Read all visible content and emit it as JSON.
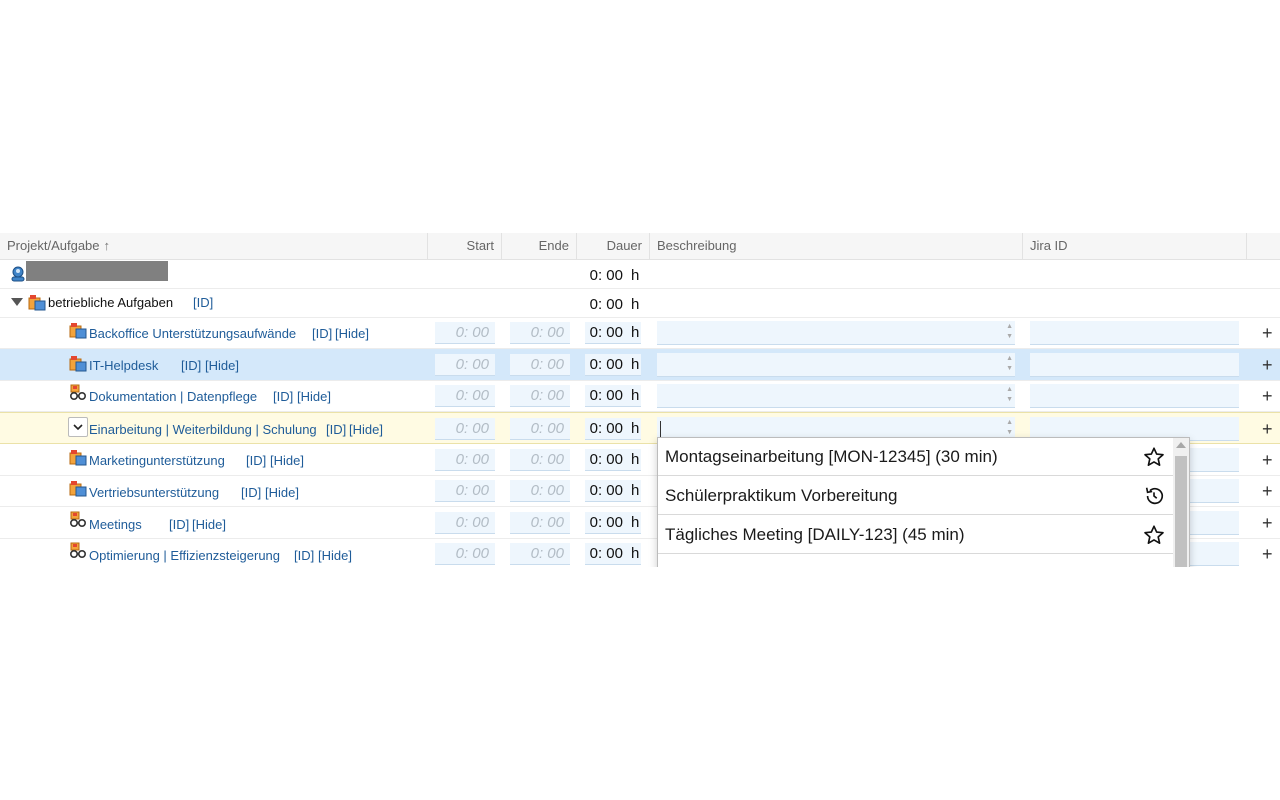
{
  "columns": {
    "task": "Projekt/Aufgabe",
    "start": "Start",
    "end": "Ende",
    "duration": "Dauer",
    "description": "Beschreibung",
    "jira": "Jira ID"
  },
  "summary_row": {
    "duration": "0: 00",
    "unit": "h"
  },
  "group": {
    "name": "betriebliche Aufgaben",
    "id_link": "[ID]",
    "duration": "0: 00",
    "unit": "h"
  },
  "time_placeholder": "0: 00",
  "tasks": [
    {
      "name": "Backoffice Unterstützungsaufwände",
      "id_link": "[ID]",
      "hide_link": "[Hide]",
      "duration": "0: 00",
      "unit": "h",
      "icon": "project-icon"
    },
    {
      "name": "IT-Helpdesk",
      "id_link": "[ID]",
      "hide_link": "[Hide]",
      "duration": "0: 00",
      "unit": "h",
      "icon": "project-icon"
    },
    {
      "name": "Dokumentation | Datenpflege",
      "id_link": "[ID]",
      "hide_link": "[Hide]",
      "duration": "0: 00",
      "unit": "h",
      "icon": "glasses-icon"
    },
    {
      "name": "Einarbeitung | Weiterbildung | Schulung",
      "id_link": "[ID]",
      "hide_link": "[Hide]",
      "duration": "0: 00",
      "unit": "h",
      "icon": "chevron-down-icon"
    },
    {
      "name": "Marketingunterstützung",
      "id_link": "[ID]",
      "hide_link": "[Hide]",
      "duration": "0: 00",
      "unit": "h",
      "icon": "project-icon"
    },
    {
      "name": "Vertriebsunterstützung",
      "id_link": "[ID]",
      "hide_link": "[Hide]",
      "duration": "0: 00",
      "unit": "h",
      "icon": "project-icon"
    },
    {
      "name": "Meetings",
      "id_link": "[ID]",
      "hide_link": "[Hide]",
      "duration": "0: 00",
      "unit": "h",
      "icon": "glasses-icon"
    },
    {
      "name": "Optimierung | Effizienzsteigerung",
      "id_link": "[ID]",
      "hide_link": "[Hide]",
      "duration": "0: 00",
      "unit": "h",
      "icon": "glasses-icon"
    }
  ],
  "add_label": "+",
  "suggestions": [
    {
      "text": "Montagseinarbeitung [MON-12345] (30 min)",
      "icon": "star-icon"
    },
    {
      "text": "Schülerpraktikum Vorbereitung",
      "icon": "history-icon"
    },
    {
      "text": "Tägliches Meeting [DAILY-123] (45 min)",
      "icon": "star-icon"
    }
  ],
  "colors": {
    "selected_row": "#d4e8fa",
    "editing_row": "#fffbe3",
    "link": "#1f5c99",
    "input_bg": "#eef6fd"
  }
}
